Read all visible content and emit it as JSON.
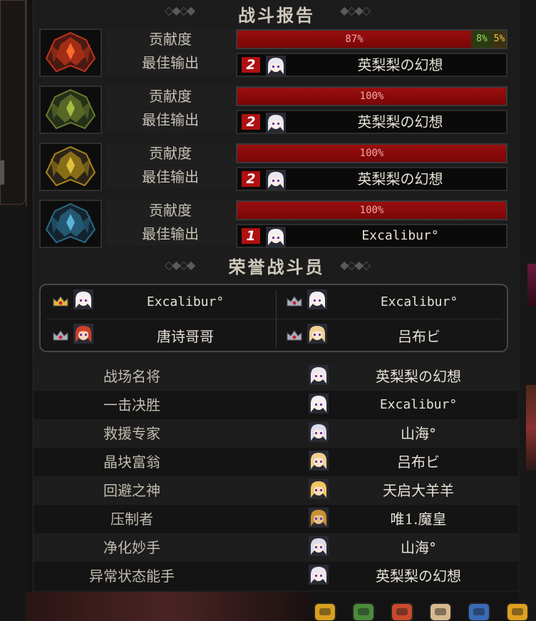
{
  "report": {
    "title": "战斗报告",
    "contribution_label": "贡献度",
    "best_output_label": "最佳输出",
    "teams": [
      {
        "emblem": "red-crest-icon",
        "contribution": "87%",
        "contribution_value": 0.87,
        "extra": [
          {
            "text": "8%",
            "value": 0.08,
            "color": "#9be05a"
          },
          {
            "text": "5%",
            "value": 0.05,
            "color": "#f0c84a"
          }
        ],
        "best_rank": "2",
        "best_player": "英梨梨の幻想"
      },
      {
        "emblem": "green-crest-icon",
        "contribution": "100%",
        "contribution_value": 1.0,
        "extra": [],
        "best_rank": "2",
        "best_player": "英梨梨の幻想"
      },
      {
        "emblem": "gold-crest-icon",
        "contribution": "100%",
        "contribution_value": 1.0,
        "extra": [],
        "best_rank": "2",
        "best_player": "英梨梨の幻想"
      },
      {
        "emblem": "blue-crest-icon",
        "contribution": "100%",
        "contribution_value": 1.0,
        "extra": [],
        "best_rank": "1",
        "best_player": "Excalibur°"
      }
    ]
  },
  "honor": {
    "title": "荣誉战斗员",
    "members": [
      {
        "name": "Excalibur°",
        "crown": "gold-crown-icon"
      },
      {
        "name": "Excalibur°",
        "crown": "silver-crown-icon"
      },
      {
        "name": "唐诗哥哥",
        "crown": "silver-crown-icon"
      },
      {
        "name": "吕布ビ",
        "crown": "silver-crown-icon"
      }
    ]
  },
  "awards": [
    {
      "title": "战场名将",
      "player": "英梨梨の幻想"
    },
    {
      "title": "一击决胜",
      "player": "Excalibur°"
    },
    {
      "title": "救援专家",
      "player": "山海°"
    },
    {
      "title": "晶块富翁",
      "player": "吕布ビ"
    },
    {
      "title": "回避之神",
      "player": "天启大羊羊"
    },
    {
      "title": "压制者",
      "player": "唯1.魔皇"
    },
    {
      "title": "净化妙手",
      "player": "山海°"
    },
    {
      "title": "异常状态能手",
      "player": "英梨梨の幻想"
    }
  ],
  "colors": {
    "bar_fill": "#9a0f0f",
    "panel_bg": "#1c1c1c",
    "text_light": "#e6e1d6",
    "text_label": "#c7c1b5"
  },
  "toolbar": [
    "star-icon",
    "house-icon",
    "potion-icon",
    "face-icon",
    "calendar-icon",
    "coin-icon"
  ]
}
